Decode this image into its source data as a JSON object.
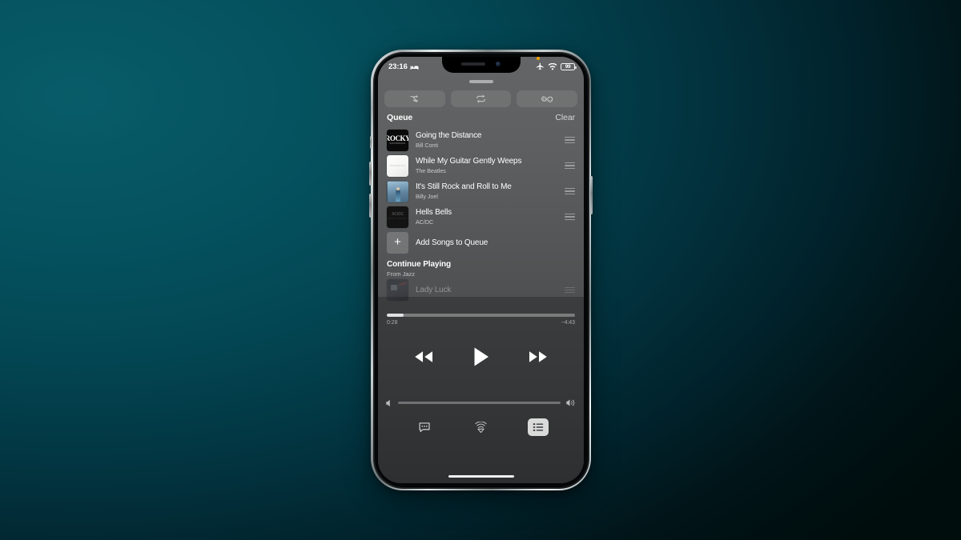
{
  "status_bar": {
    "time": "23:16",
    "bed_icon": "bed-icon",
    "airplane_icon": "airplane-mode-icon",
    "wifi_icon": "wifi-icon",
    "battery_level": "99",
    "recording_indicator": "orange-recording-dot"
  },
  "mode_buttons": [
    {
      "name": "shuffle",
      "icon": "shuffle-icon",
      "active": false
    },
    {
      "name": "repeat",
      "icon": "repeat-icon",
      "active": false
    },
    {
      "name": "infinite",
      "icon": "infinity-icon",
      "active": false
    }
  ],
  "queue": {
    "header": "Queue",
    "clear_label": "Clear",
    "items": [
      {
        "title": "Going the Distance",
        "artist": "Bill Conti",
        "art": "rocky",
        "art_text": "ROCKY",
        "art_sub": "SOUNDTRACK"
      },
      {
        "title": "While My Guitar Gently Weeps",
        "artist": "The Beatles",
        "art": "white",
        "art_text": "THE BEATLES"
      },
      {
        "title": "It's Still Rock and Roll to Me",
        "artist": "Billy Joel",
        "art": "glass"
      },
      {
        "title": "Hells Bells",
        "artist": "AC/DC",
        "art": "acdc",
        "art_text": "AC/DC",
        "art_sub": "BACK IN BLACK"
      }
    ],
    "add_label": "Add Songs to Queue",
    "add_icon": "plus-icon"
  },
  "continue_playing": {
    "title": "Continue Playing",
    "source": "From Jazz",
    "items": [
      {
        "title": "Lady Luck",
        "art": "jazz"
      }
    ]
  },
  "player": {
    "elapsed": "0:28",
    "remaining": "−4:43",
    "progress_percent": 9,
    "rewind_icon": "rewind-icon",
    "play_icon": "play-icon",
    "forward_icon": "fast-forward-icon",
    "volume_percent": 100,
    "volume_low_icon": "volume-low-icon",
    "volume_high_icon": "volume-high-icon"
  },
  "tab_bar": [
    {
      "name": "lyrics",
      "icon": "lyrics-bubble-icon",
      "active": false
    },
    {
      "name": "airplay",
      "icon": "airplay-icon",
      "active": false
    },
    {
      "name": "queue",
      "icon": "queue-list-icon",
      "active": true
    }
  ],
  "colors": {
    "background_teal": "#05525f",
    "background_dark": "#000d0d",
    "panel_light": "#5e6061",
    "panel_dark": "#35373a",
    "accent_white": "#ffffff",
    "battery_text": "#ffffff"
  }
}
